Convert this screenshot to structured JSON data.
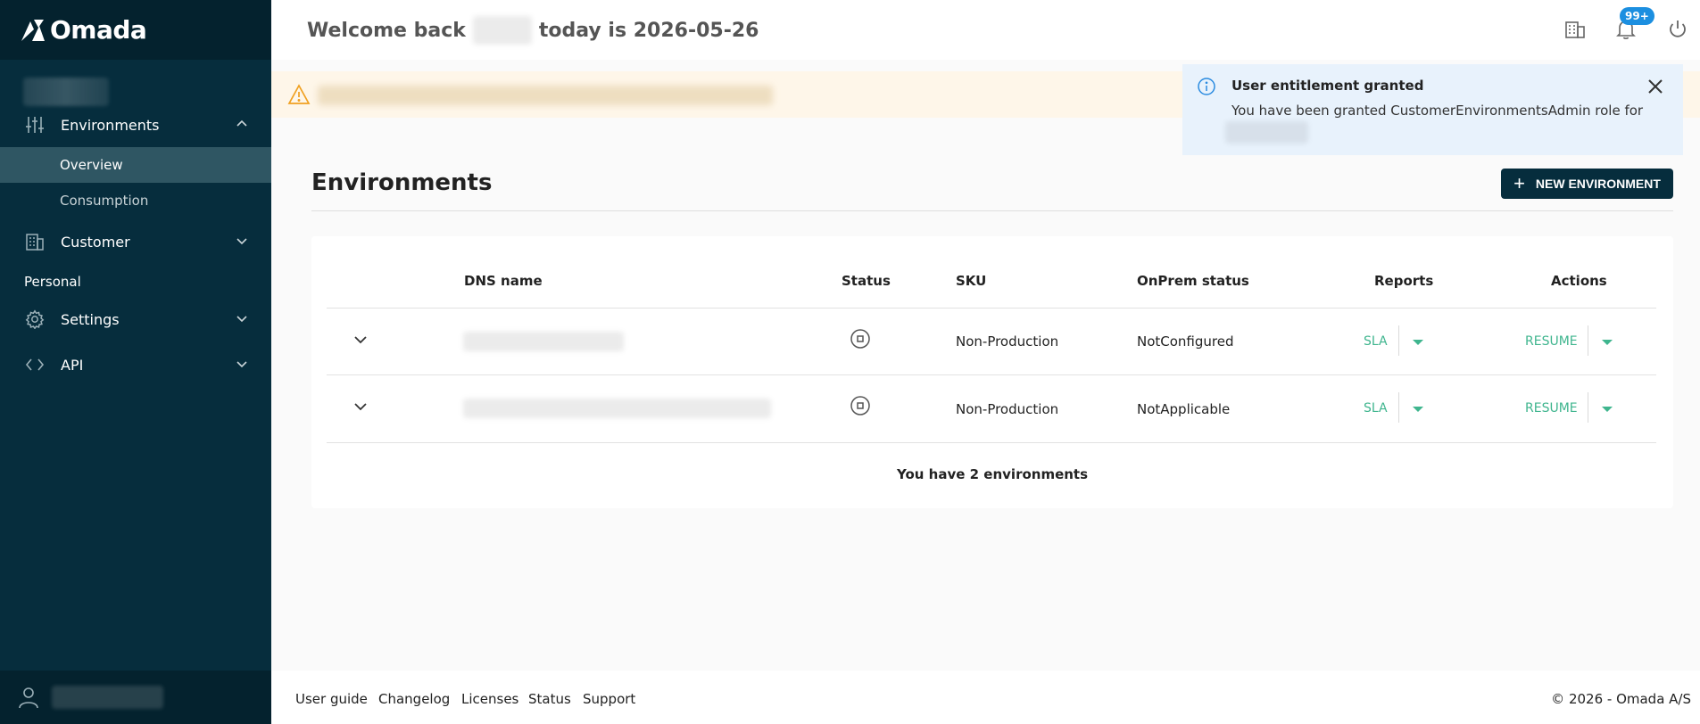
{
  "brand": {
    "name": "Omada"
  },
  "sidebar": {
    "environments_label": "Environments",
    "overview_label": "Overview",
    "consumption_label": "Consumption",
    "customer_label": "Customer",
    "personal_label": "Personal",
    "settings_label": "Settings",
    "api_label": "API"
  },
  "header": {
    "welcome_prefix": "Welcome back",
    "welcome_suffix": "today is 2026-05-26",
    "notification_badge": "99+"
  },
  "toast": {
    "title": "User entitlement granted",
    "message": "You have been granted CustomerEnvironmentsAdmin role for"
  },
  "main": {
    "title": "Environments",
    "new_button": "NEW ENVIRONMENT",
    "columns": {
      "dns": "DNS name",
      "status": "Status",
      "sku": "SKU",
      "onprem": "OnPrem status",
      "reports": "Reports",
      "actions": "Actions"
    },
    "rows": [
      {
        "sku": "Non-Production",
        "onprem": "NotConfigured",
        "report": "SLA",
        "action": "RESUME"
      },
      {
        "sku": "Non-Production",
        "onprem": "NotApplicable",
        "report": "SLA",
        "action": "RESUME"
      }
    ],
    "count_text": "You have 2 environments"
  },
  "footer": {
    "user_guide": "User guide",
    "changelog": "Changelog",
    "licenses": "Licenses",
    "status": "Status",
    "support": "Support",
    "copyright": "© 2026 - Omada A/S"
  },
  "colors": {
    "sidebar_bg": "#062d3d",
    "accent_green": "#3fb58e",
    "badge_blue": "#1c8fe0",
    "warning_bg": "#fef6e9",
    "toast_bg": "#e8f2fc"
  }
}
